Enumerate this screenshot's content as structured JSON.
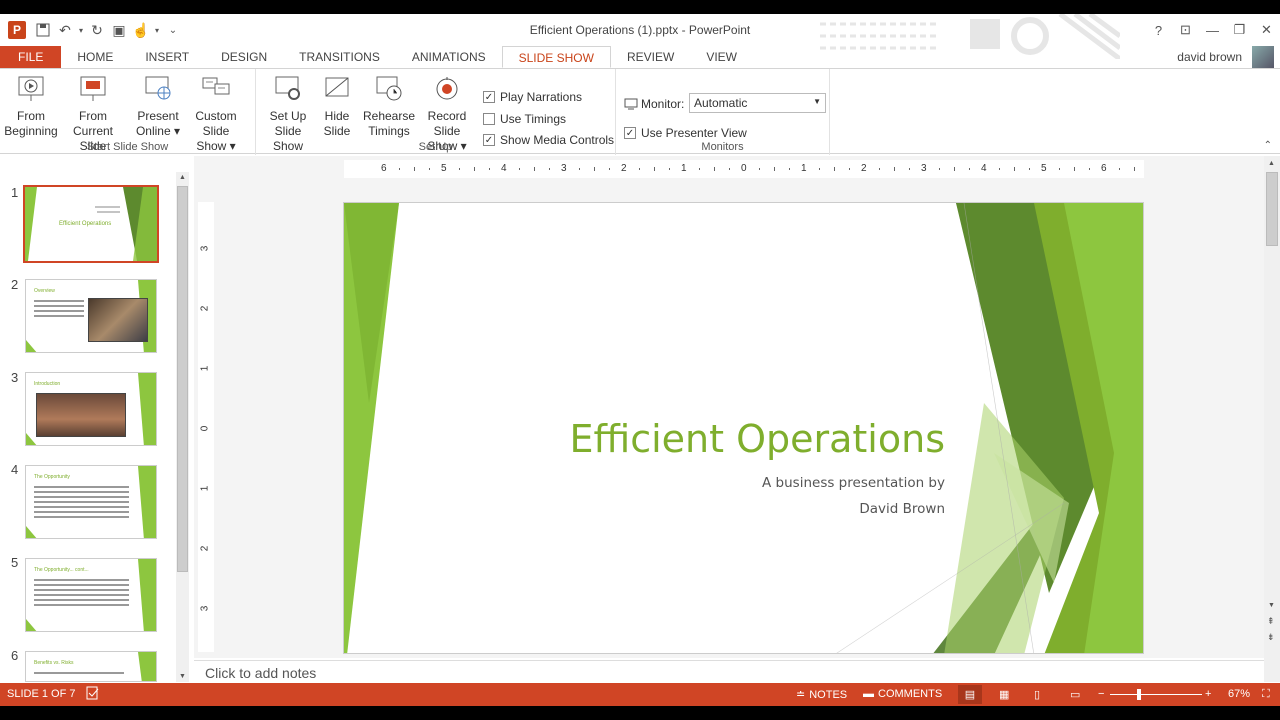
{
  "window": {
    "title": "Efficient Operations (1).pptx - PowerPoint",
    "user": "david brown",
    "controls": [
      "?",
      "▭",
      "—",
      "❐",
      "✕"
    ]
  },
  "tabs": [
    {
      "label": "FILE",
      "active": false
    },
    {
      "label": "HOME",
      "active": false
    },
    {
      "label": "INSERT",
      "active": false
    },
    {
      "label": "DESIGN",
      "active": false
    },
    {
      "label": "TRANSITIONS",
      "active": false
    },
    {
      "label": "ANIMATIONS",
      "active": false
    },
    {
      "label": "SLIDE SHOW",
      "active": true
    },
    {
      "label": "REVIEW",
      "active": false
    },
    {
      "label": "VIEW",
      "active": false
    }
  ],
  "ribbon": {
    "start": {
      "label": "Start Slide Show",
      "from_beginning": [
        "From",
        "Beginning"
      ],
      "from_current": [
        "From",
        "Current Slide"
      ],
      "present_online": [
        "Present",
        "Online ▾"
      ],
      "custom": [
        "Custom Slide",
        "Show ▾"
      ]
    },
    "setup": {
      "label": "Set Up",
      "setup_show": [
        "Set Up",
        "Slide Show"
      ],
      "hide_slide": [
        "Hide",
        "Slide"
      ],
      "rehearse": [
        "Rehearse",
        "Timings"
      ],
      "record": [
        "Record Slide",
        "Show ▾"
      ],
      "play_narrations": {
        "label": "Play Narrations",
        "checked": true
      },
      "use_timings": {
        "label": "Use Timings",
        "checked": false
      },
      "show_media": {
        "label": "Show Media Controls",
        "checked": true
      }
    },
    "monitors": {
      "label": "Monitors",
      "monitor_label": "Monitor:",
      "monitor_value": "Automatic",
      "presenter_view": {
        "label": "Use Presenter View",
        "checked": true
      }
    }
  },
  "thumbnails": [
    {
      "num": "1",
      "title": "Efficient Operations",
      "selected": true
    },
    {
      "num": "2",
      "title": "Overview",
      "selected": false
    },
    {
      "num": "3",
      "title": "Introduction",
      "selected": false
    },
    {
      "num": "4",
      "title": "The Opportunity",
      "selected": false
    },
    {
      "num": "5",
      "title": "The Opportunity... cont...",
      "selected": false
    },
    {
      "num": "6",
      "title": "Benefits vs. Risks",
      "selected": false
    }
  ],
  "rulers": {
    "horizontal": [
      "6",
      "5",
      "4",
      "3",
      "2",
      "1",
      "0",
      "1",
      "2",
      "3",
      "4",
      "5",
      "6"
    ],
    "vertical": [
      "3",
      "2",
      "1",
      "0",
      "1",
      "2",
      "3"
    ]
  },
  "slide": {
    "title": "Efficient Operations",
    "subtitle_line1": "A business presentation by",
    "subtitle_line2": "David Brown",
    "accent": "#7fae2d"
  },
  "notes_placeholder": "Click to add notes",
  "status": {
    "slide": "SLIDE 1 OF 7",
    "notes": "NOTES",
    "comments": "COMMENTS",
    "zoom": "67%",
    "bar_color": "#d04525"
  }
}
